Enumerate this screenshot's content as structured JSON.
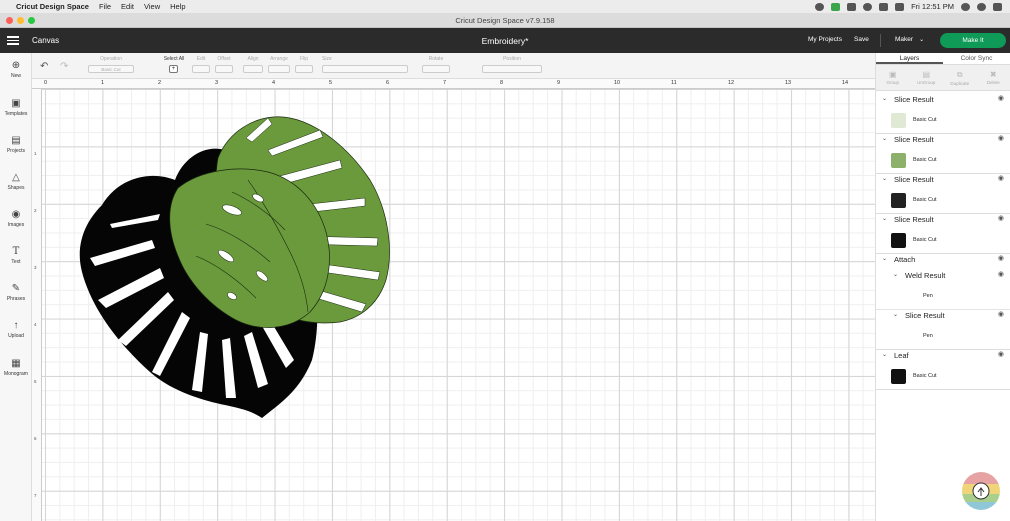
{
  "colors": {
    "header_bg": "#2b2b2b",
    "make_it_green": "#0f9a57",
    "leaf_green": "#6a9a3c",
    "leaf_black": "#050505",
    "traffic_red": "#fe5f57",
    "traffic_yellow": "#febc2e",
    "traffic_green": "#28c840"
  },
  "menubar": {
    "apple_icon": "apple-icon",
    "app_name": "Cricut Design Space",
    "items": [
      "File",
      "Edit",
      "View",
      "Help"
    ],
    "clock": "Fri 12:51 PM"
  },
  "window": {
    "title": "Cricut Design Space  v7.9.158"
  },
  "header": {
    "section": "Canvas",
    "document_name": "Embroidery*",
    "my_projects": "My Projects",
    "save": "Save",
    "machine": "Maker",
    "make_it": "Make It"
  },
  "left_tools": [
    "New",
    "Templates",
    "Projects",
    "Shapes",
    "Images",
    "Text",
    "Phrases",
    "Upload",
    "Monogram"
  ],
  "edit_toolbar": {
    "operation_label": "Operation",
    "operation_value": "Basic Cut",
    "select_all": "Select All",
    "edit": "Edit",
    "offset": "Offset",
    "align": "Align",
    "arrange": "Arrange",
    "flip": "Flip",
    "size": "Size",
    "rotate": "Rotate",
    "position": "Position"
  },
  "ruler": {
    "labels": [
      "0",
      "1",
      "2",
      "3",
      "4",
      "5",
      "6",
      "7",
      "8",
      "9",
      "10",
      "11",
      "12",
      "13",
      "14"
    ],
    "vlabels": [
      "1",
      "2",
      "3",
      "4",
      "5",
      "6",
      "7"
    ]
  },
  "right_panel": {
    "tabs": [
      "Layers",
      "Color Sync"
    ],
    "tools": [
      "Group",
      "UnGroup",
      "Duplicate",
      "Delete"
    ],
    "layers": [
      {
        "name": "Slice Result",
        "type": "Basic Cut",
        "thumb": "green"
      },
      {
        "name": "Slice Result",
        "type": "Basic Cut",
        "thumb": "green"
      },
      {
        "name": "Slice Result",
        "type": "Basic Cut",
        "thumb": "black"
      },
      {
        "name": "Slice Result",
        "type": "Basic Cut",
        "thumb": "black"
      }
    ],
    "attach": {
      "name": "Attach",
      "children": [
        {
          "name": "Weld Result",
          "type": "Pen"
        },
        {
          "name": "Slice Result",
          "type": "Pen"
        }
      ]
    },
    "leaf": {
      "name": "Leaf",
      "type": "Basic Cut"
    }
  }
}
